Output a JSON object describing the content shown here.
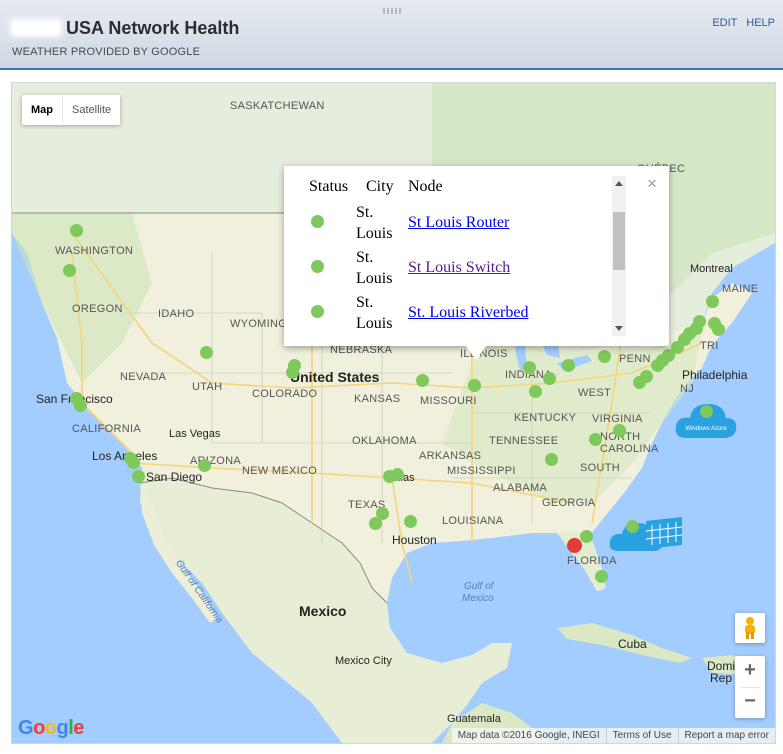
{
  "header": {
    "title": "USA Network Health",
    "subtitle": "WEATHER PROVIDED BY GOOGLE",
    "edit_label": "EDIT",
    "help_label": "HELP"
  },
  "map": {
    "type_map_label": "Map",
    "type_satellite_label": "Satellite",
    "zoom_in": "+",
    "zoom_out": "−",
    "attribution": {
      "data": "Map data ©2016 Google, INEGI",
      "terms": "Terms of Use",
      "report": "Report a map error"
    },
    "logo": [
      "G",
      "o",
      "o",
      "g",
      "l",
      "e"
    ],
    "labels": {
      "saskatchewan": "SASKATCHEWAN",
      "quebec": "QUÉBEC",
      "washington": "WASHINGTON",
      "montreal": "Montreal",
      "oregon": "OREGON",
      "idaho": "IDAHO",
      "wyoming": "WYOMING",
      "maine": "MAINE",
      "nebraska": "NEBRASKA",
      "illinois": "ILLINOIS",
      "nevada": "NEVADA",
      "utah": "UTAH",
      "united_states": "United States",
      "indiana": "INDIANA",
      "penn": "PENN",
      "philadelphia": "Philadelphia",
      "nj": "NJ",
      "tri": "TRI",
      "san_francisco": "San Francisco",
      "colorado": "COLORADO",
      "kansas": "KANSAS",
      "missouri": "MISSOURI",
      "west": "WEST",
      "kentucky": "KENTUCKY",
      "virginia": "VIRGINIA",
      "california": "CALIFORNIA",
      "las_vegas": "Las Vegas",
      "oklahoma": "OKLAHOMA",
      "tennessee": "TENNESSEE",
      "north": "NORTH",
      "carolina": "CAROLINA",
      "los_angeles": "Los Angeles",
      "arizona": "ARIZONA",
      "new_mexico": "NEW MEXICO",
      "arkansas": "ARKANSAS",
      "south": "SOUTH",
      "san_diego": "San Diego",
      "mississippi": "MISSISSIPPI",
      "alabama": "ALABAMA",
      "georgia": "GEORGIA",
      "dallas": "Dallas",
      "texas": "TEXAS",
      "louisiana": "LOUISIANA",
      "houston": "Houston",
      "florida": "FLORIDA",
      "gulf_of_california": "Gulf of California",
      "gulf_of_mexico_1": "Gulf of",
      "gulf_of_mexico_2": "Mexico",
      "mexico": "Mexico",
      "cuba": "Cuba",
      "mexico_city": "Mexico City",
      "dom": "Domi",
      "rep": "Rep",
      "guatemala": "Guatemala",
      "windows_azure": "Windows Azure"
    }
  },
  "popup": {
    "headers": {
      "status": "Status",
      "city": "City",
      "node": "Node"
    },
    "close": "×",
    "rows": [
      {
        "status_color": "#7ec85c",
        "city_line1": "St.",
        "city_line2": "Louis",
        "node": "St Louis Router"
      },
      {
        "status_color": "#7ec85c",
        "city_line1": "St.",
        "city_line2": "Louis",
        "node": "St Louis Switch"
      },
      {
        "status_color": "#7ec85c",
        "city_line1": "St.",
        "city_line2": "Louis",
        "node": "St. Louis Riverbed"
      }
    ]
  },
  "colors": {
    "up": "#7ec85c",
    "down": "#e63a3a",
    "land": "#e8f0d8",
    "water": "#a3ccff"
  }
}
